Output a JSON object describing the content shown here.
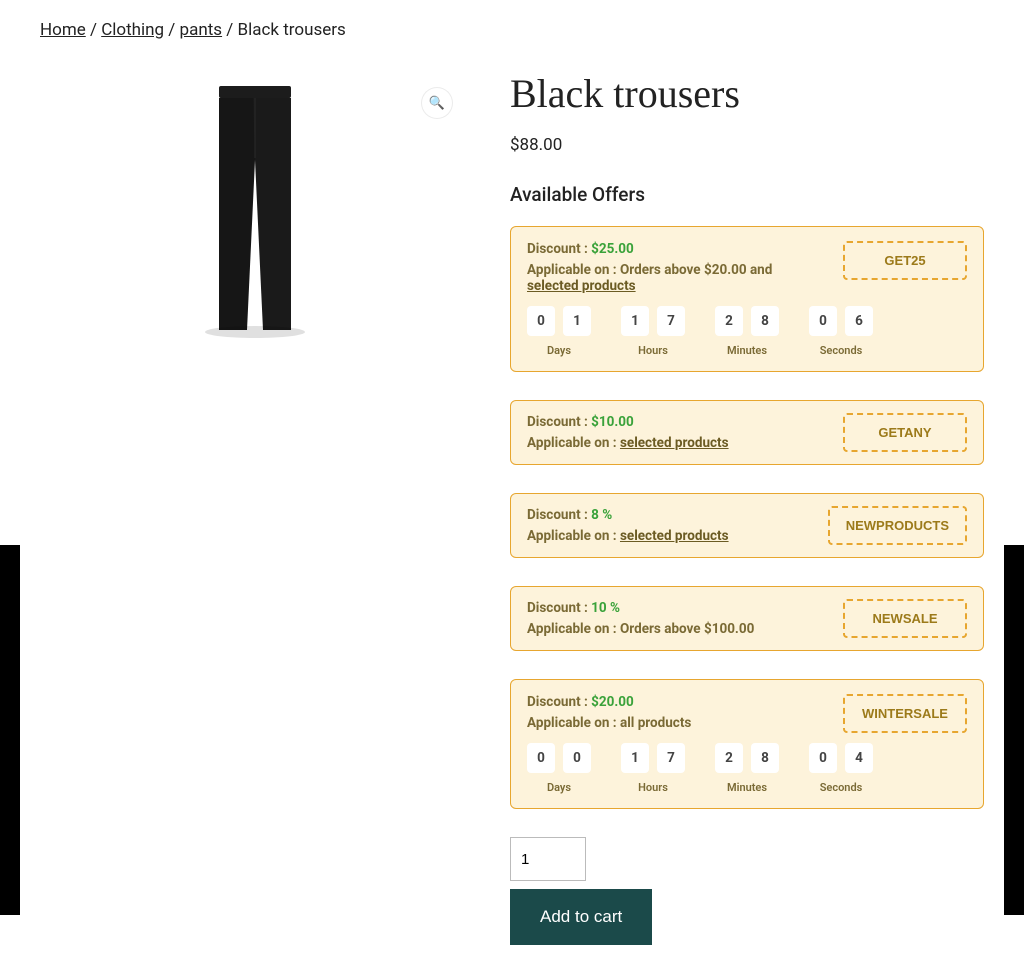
{
  "breadcrumb": {
    "home": "Home",
    "sep": " / ",
    "cat1": "Clothing",
    "cat2": "pants",
    "current": "Black trousers"
  },
  "product": {
    "title": "Black trousers",
    "price": "$88.00",
    "available_offers_heading": "Available Offers",
    "zoom_icon": "🔍"
  },
  "offer_labels": {
    "discount": "Discount :",
    "applicable": "Applicable on :",
    "days": "Days",
    "hours": "Hours",
    "minutes": "Minutes",
    "seconds": "Seconds"
  },
  "offers": [
    {
      "discount": "$25.00",
      "applicable_prefix": "Orders above $20.00 and ",
      "applicable_link": "selected products",
      "code": "GET25",
      "countdown": {
        "days": [
          "0",
          "1"
        ],
        "hours": [
          "1",
          "7"
        ],
        "minutes": [
          "2",
          "8"
        ],
        "seconds": [
          "0",
          "6"
        ]
      }
    },
    {
      "discount": "$10.00",
      "applicable_prefix": "",
      "applicable_link": "selected products",
      "code": "GETANY"
    },
    {
      "discount": "8 %",
      "applicable_prefix": "",
      "applicable_link": "selected products",
      "code": "NEWPRODUCTS"
    },
    {
      "discount": "10 %",
      "applicable_prefix": "Orders above $100.00",
      "applicable_link": "",
      "code": "NEWSALE"
    },
    {
      "discount": "$20.00",
      "applicable_prefix": "all products",
      "applicable_link": "",
      "code": "WINTERSALE",
      "countdown": {
        "days": [
          "0",
          "0"
        ],
        "hours": [
          "1",
          "7"
        ],
        "minutes": [
          "2",
          "8"
        ],
        "seconds": [
          "0",
          "4"
        ]
      }
    }
  ],
  "cart": {
    "qty": "1",
    "add": "Add to cart"
  }
}
